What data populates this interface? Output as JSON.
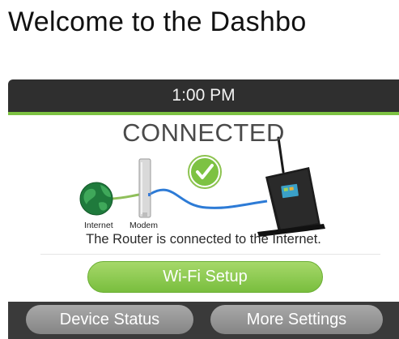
{
  "page": {
    "heading": "Welcome to the Dashbo"
  },
  "status_bar": {
    "time": "1:00 PM"
  },
  "connection": {
    "title": "CONNECTED",
    "message": "The Router is connected to the Internet.",
    "diagram_labels": {
      "internet": "Internet",
      "modem": "Modem"
    },
    "icons": {
      "check": "check-icon",
      "globe": "globe-icon",
      "modem": "modem-icon",
      "router": "router-icon"
    }
  },
  "actions": {
    "wifi_setup": "Wi-Fi Setup",
    "device_status": "Device Status",
    "more_settings": "More Settings"
  },
  "colors": {
    "accent_green": "#7dc242",
    "frame_dark": "#2f2f2f",
    "cable_blue": "#2d7bd6",
    "button_gray": "#999999"
  }
}
